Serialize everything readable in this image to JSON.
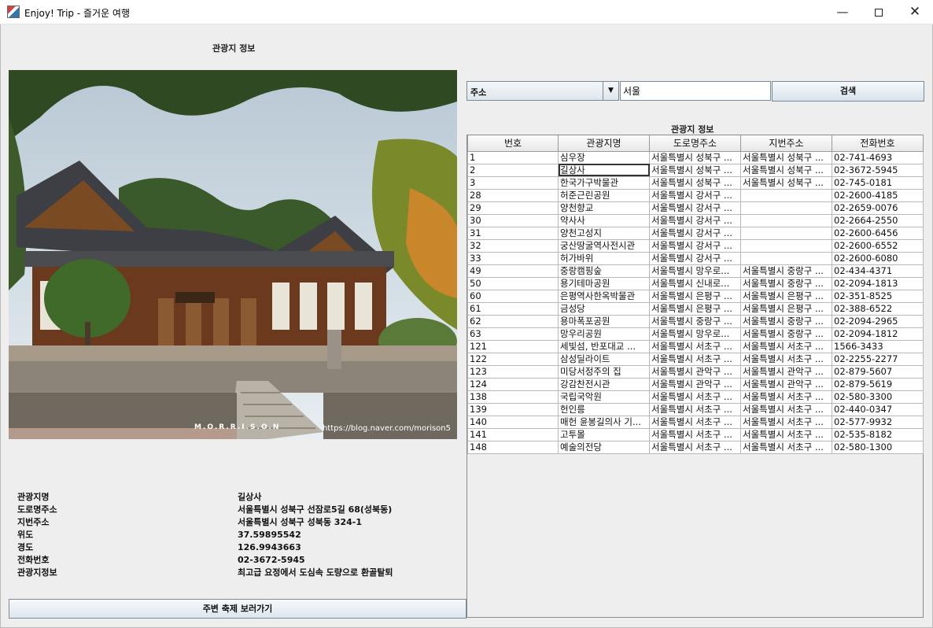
{
  "window": {
    "title": "Enjoy! Trip - 즐거운 여행",
    "min_glyph": "—",
    "close_glyph": "✕"
  },
  "left_panel": {
    "title": "관광지 정보",
    "photo": {
      "credit": "https://blog.naver.com/morison5",
      "signature": "M.O.R.R.I.S.O.N"
    },
    "details": [
      {
        "label": "관광지명",
        "value": "길상사"
      },
      {
        "label": "도로명주소",
        "value": "서울특별시 성북구 선잠로5길 68(성북동)"
      },
      {
        "label": "지번주소",
        "value": "서울특별시 성북구 성북동 324-1"
      },
      {
        "label": "위도",
        "value": "37.59895542"
      },
      {
        "label": "경도",
        "value": "126.9943663"
      },
      {
        "label": "전화번호",
        "value": "02-3672-5945"
      },
      {
        "label": "관광지정보",
        "value": "최고급 요정에서 도심속 도량으로 환골탈퇴"
      }
    ],
    "bottom_button": "주변 축제 보러가기"
  },
  "search": {
    "select_value": "주소",
    "select_arrow": "▼",
    "input_value": "서울",
    "button_label": "검색"
  },
  "table": {
    "title": "관광지 정보",
    "columns": [
      "번호",
      "관광지명",
      "도로명주소",
      "지번주소",
      "전화번호"
    ],
    "selected_row": 1,
    "rows": [
      [
        "1",
        "심우장",
        "서울특별시 성북구 ...",
        "서울특별시 성북구 ...",
        "02-741-4693"
      ],
      [
        "2",
        "길상사",
        "서울특별시 성북구 ...",
        "서울특별시 성북구 ...",
        "02-3672-5945"
      ],
      [
        "3",
        "한국가구박물관",
        "서울특별시 성북구 ...",
        "서울특별시 성북구 ...",
        "02-745-0181"
      ],
      [
        "28",
        "허준근린공원",
        "서울특별시 강서구 ...",
        "",
        "02-2600-4185"
      ],
      [
        "29",
        "양천향교",
        "서울특별시 강서구 ...",
        "",
        "02-2659-0076"
      ],
      [
        "30",
        "약사사",
        "서울특별시 강서구 ...",
        "",
        "02-2664-2550"
      ],
      [
        "31",
        "양천고성지",
        "서울특별시 강서구 ...",
        "",
        "02-2600-6456"
      ],
      [
        "32",
        "궁산땅굴역사전시관",
        "서울특별시 강서구 ...",
        "",
        "02-2600-6552"
      ],
      [
        "33",
        "허가바위",
        "서울특별시 강서구 ...",
        "",
        "02-2600-6080"
      ],
      [
        "49",
        "중랑캠핑숲",
        "서울특별시 망우로...",
        "서울특별시 중랑구 ...",
        "02-434-4371"
      ],
      [
        "50",
        "용기테마공원",
        "서울특별시 신내로...",
        "서울특별시 중랑구 ...",
        "02-2094-1813"
      ],
      [
        "60",
        "은평역사한옥박물관",
        "서울특별시 은평구 ...",
        "서울특별시 은평구 ...",
        "02-351-8525"
      ],
      [
        "61",
        "금성당",
        "서울특별시 은평구 ...",
        "서울특별시 은평구 ...",
        "02-388-6522"
      ],
      [
        "62",
        "용마폭포공원",
        "서울특별시 중랑구 ...",
        "서울특별시 중랑구 ...",
        "02-2094-2965"
      ],
      [
        "63",
        "망우리공원",
        "서울특별시 망우로...",
        "서울특별시 중랑구 ...",
        "02-2094-1812"
      ],
      [
        "121",
        "세빛섬, 반포대교 ...",
        "서울특별시 서초구 ...",
        "서울특별시 서초구 ...",
        "1566-3433"
      ],
      [
        "122",
        "삼성딜라이트",
        "서울특별시 서초구 ...",
        "서울특별시 서초구 ...",
        "02-2255-2277"
      ],
      [
        "123",
        "미당서정주의 집",
        "서울특별시 관악구 ...",
        "서울특별시 관악구 ...",
        "02-879-5607"
      ],
      [
        "124",
        "강감찬전시관",
        "서울특별시 관악구 ...",
        "서울특별시 관악구 ...",
        "02-879-5619"
      ],
      [
        "138",
        "국립국악원",
        "서울특별시 서초구 ...",
        "서울특별시 서초구 ...",
        "02-580-3300"
      ],
      [
        "139",
        "헌인릉",
        "서울특별시 서초구 ...",
        "서울특별시 서초구 ...",
        "02-440-0347"
      ],
      [
        "140",
        "매헌 윤봉길의사 기...",
        "서울특별시 서초구 ...",
        "서울특별시 서초구 ...",
        "02-577-9932"
      ],
      [
        "141",
        "고투몰",
        "서울특별시 서초구 ...",
        "서울특별시 서초구 ...",
        "02-535-8182"
      ],
      [
        "148",
        "예술의전당",
        "서울특별시 서초구 ...",
        "서울특별시 서초구 ...",
        "02-580-1300"
      ]
    ]
  }
}
